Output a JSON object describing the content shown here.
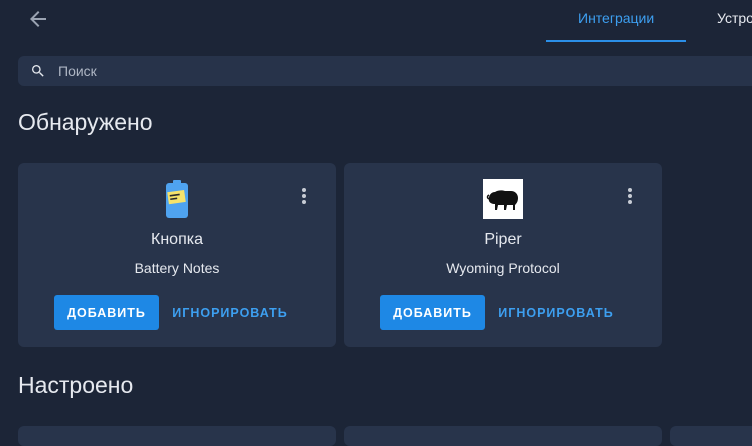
{
  "header": {
    "back_icon": "arrow-left-icon",
    "tabs": [
      {
        "label": "Интеграции",
        "active": true
      },
      {
        "label": "Устро",
        "active": false
      }
    ],
    "accent_color": "#3d9ff0"
  },
  "search": {
    "placeholder": "Поиск",
    "value": "",
    "icon": "search-icon"
  },
  "sections": {
    "discovered_title": "Обнаружено",
    "configured_title": "Настроено"
  },
  "cards": [
    {
      "title": "Кнопка",
      "subtitle": "Battery Notes",
      "icon": "battery-notes-icon",
      "add_label": "ДОБАВИТЬ",
      "ignore_label": "ИГНОРИРОВАТЬ"
    },
    {
      "title": "Piper",
      "subtitle": "Wyoming Protocol",
      "icon": "wyoming-bison-icon",
      "add_label": "ДОБАВИТЬ",
      "ignore_label": "ИГНОРИРОВАТЬ"
    }
  ],
  "colors": {
    "background": "#1c2537",
    "card": "#28344b",
    "primary_button": "#1e88e5"
  }
}
